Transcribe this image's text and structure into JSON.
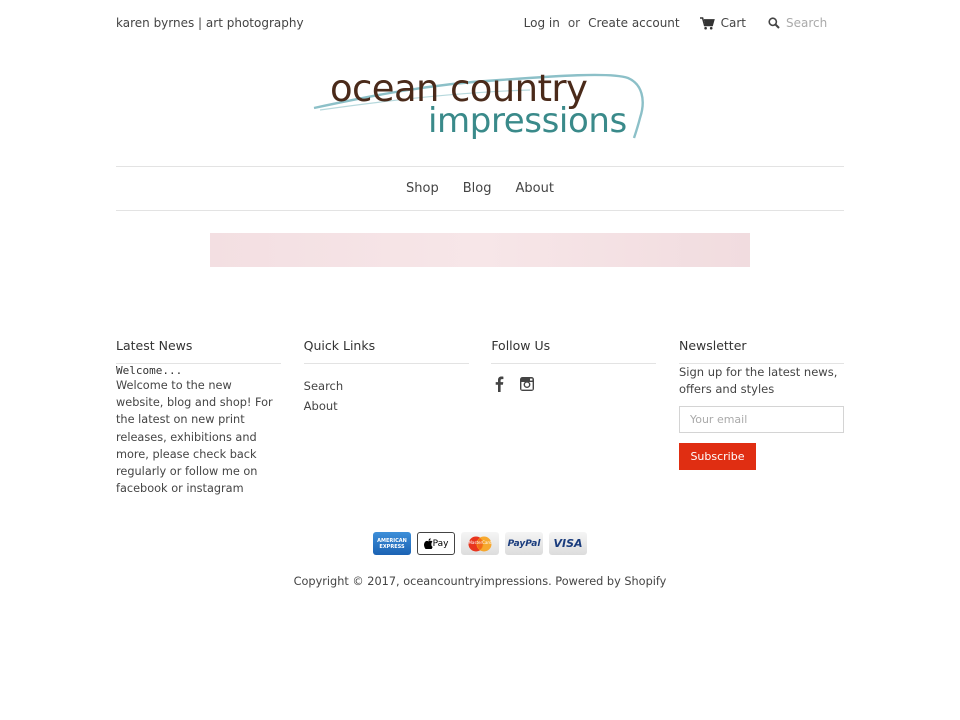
{
  "header": {
    "tagline": "karen byrnes | art photography",
    "login": "Log in",
    "or": "or",
    "create_account": "Create account",
    "cart": "Cart",
    "search_placeholder": "Search"
  },
  "logo": {
    "line1": "ocean country",
    "line2": "impressions"
  },
  "nav": [
    "Shop",
    "Blog",
    "About"
  ],
  "footer": {
    "latest_news": {
      "heading": "Latest News",
      "post_title": "Welcome...",
      "post_body": "Welcome to the new website, blog and shop!  For the latest on new print releases, exhibitions and more, please check back regularly or follow me on facebook or instagram"
    },
    "quick_links": {
      "heading": "Quick Links",
      "items": [
        "Search",
        "About"
      ]
    },
    "follow_us": {
      "heading": "Follow Us",
      "icons": [
        "facebook-icon",
        "instagram-icon"
      ]
    },
    "newsletter": {
      "heading": "Newsletter",
      "text": "Sign up for the latest news, offers and styles",
      "email_placeholder": "Your email",
      "button": "Subscribe"
    }
  },
  "payments": {
    "amex": "AMERICAN EXPRESS",
    "apple_pay": "Pay",
    "mastercard": "MasterCard",
    "paypal": "PayPal",
    "visa": "VISA"
  },
  "copyright": "Copyright © 2017, oceancountryimpressions. Powered by Shopify",
  "colors": {
    "accent": "#e02e12",
    "logo_brown": "#4a2a1a",
    "logo_teal": "#3a8a8a",
    "banner": "#f3dfe2"
  }
}
